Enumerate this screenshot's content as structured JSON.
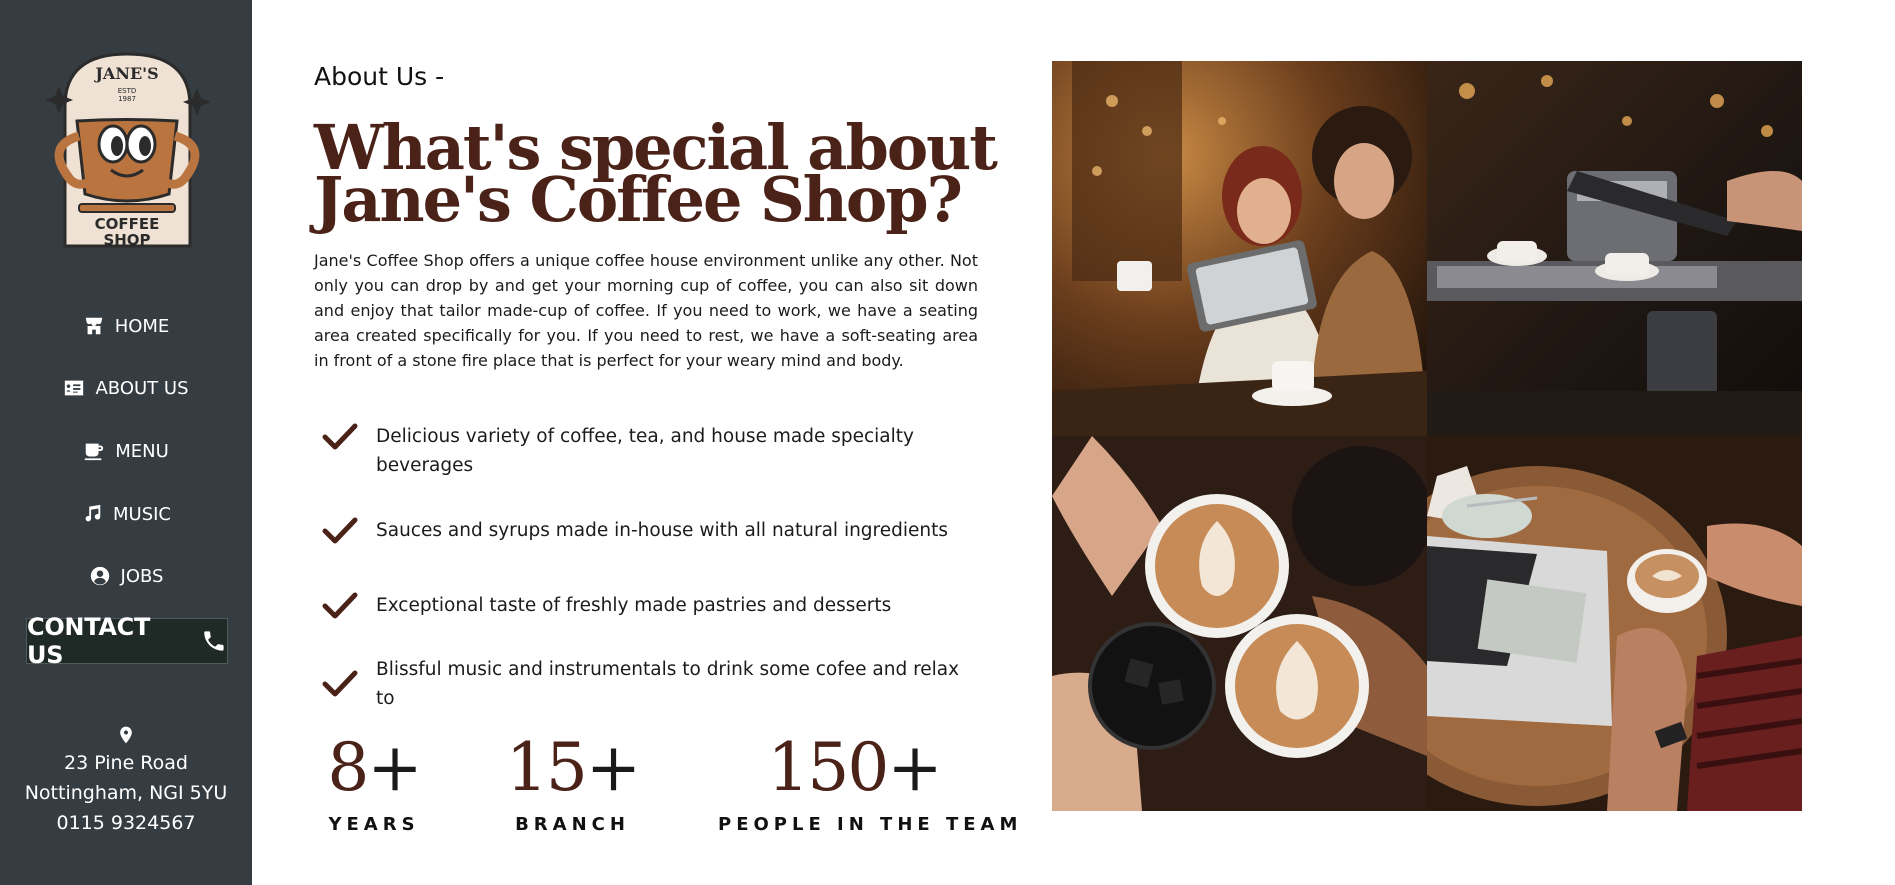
{
  "sidebar": {
    "logo": {
      "top_text": "JANE'S",
      "estd": "ESTD 1987",
      "bottom_line1": "COFFEE",
      "bottom_line2": "SHOP"
    },
    "nav": [
      {
        "label": "HOME",
        "icon": "store-icon"
      },
      {
        "label": "ABOUT US",
        "icon": "id-card-icon"
      },
      {
        "label": "MENU",
        "icon": "mug-icon"
      },
      {
        "label": "MUSIC",
        "icon": "music-note-icon"
      },
      {
        "label": "JOBS",
        "icon": "user-circle-icon"
      }
    ],
    "contact_label": "CONTACT US",
    "address": {
      "line1": "23 Pine Road",
      "line2": "Nottingham, NGI 5YU",
      "phone": "0115 9324567"
    }
  },
  "main": {
    "eyebrow": "About Us -",
    "headline_line1": "What's special about",
    "headline_line2": "Jane's Coffee Shop?",
    "intro": "Jane's Coffee Shop offers a unique coffee house environment unlike any other. Not only you can drop by and get your morning cup of coffee, you can also sit down and enjoy that tailor made-cup of coffee. If you need to work, we have a seating area created specifically for you. If you need to rest, we have a soft-seating area in front of a stone fire place that is perfect for your weary mind and body.",
    "features": [
      "Delicious variety of coffee, tea, and house made specialty beverages",
      "Sauces and syrups made in-house with all natural ingredients",
      "Exceptional taste of freshly made pastries and desserts",
      "Blissful music and instrumentals to drink some cofee and relax to"
    ],
    "stats": [
      {
        "number": "8",
        "suffix": "+",
        "label": "YEARS"
      },
      {
        "number": "15",
        "suffix": "+",
        "label": "BRANCH"
      },
      {
        "number": "150",
        "suffix": "+",
        "label": "PEOPLE IN THE TEAM"
      }
    ]
  },
  "gallery": {
    "photos": [
      "couple-with-tablet-photo",
      "espresso-machine-photo",
      "latte-art-cheers-photo",
      "laptop-and-coffee-photo"
    ]
  },
  "colors": {
    "sidebar_bg": "#363d42",
    "brand_brown": "#4a2218",
    "contact_bg": "#1f2926"
  }
}
